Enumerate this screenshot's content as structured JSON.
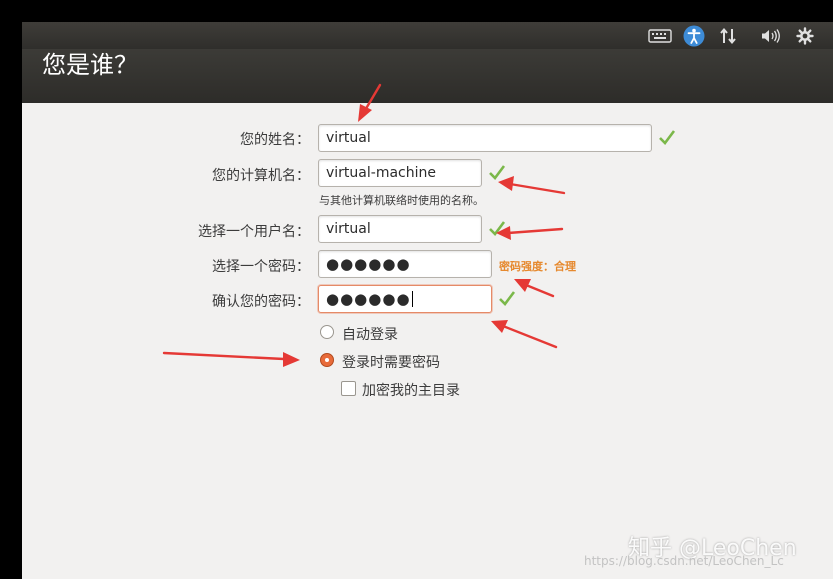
{
  "header": {
    "title": "您是谁？"
  },
  "topbar": {
    "icons": [
      "keyboard-icon",
      "accessibility-icon",
      "network-icon",
      "volume-icon",
      "gear-icon"
    ]
  },
  "form": {
    "name": {
      "label": "您的姓名：",
      "value": "virtual"
    },
    "computer": {
      "label": "您的计算机名：",
      "value": "virtual-machine",
      "hint": "与其他计算机联络时使用的名称。"
    },
    "username": {
      "label": "选择一个用户名：",
      "value": "virtual"
    },
    "password": {
      "label": "选择一个密码：",
      "value": "●●●●●●",
      "strength": "密码强度：合理"
    },
    "confirm": {
      "label": "确认您的密码：",
      "value": "●●●●●●"
    }
  },
  "login": {
    "auto": {
      "label": "自动登录",
      "selected": false
    },
    "require": {
      "label": "登录时需要密码",
      "selected": true
    },
    "encrypt": {
      "label": "加密我的主目录",
      "checked": false
    }
  },
  "watermark": {
    "text": "知乎 @LeoChen",
    "url": "https://blog.csdn.net/LeoChen_Lc"
  },
  "colors": {
    "check": "#7bb84a",
    "annotation": "#e53935",
    "accent": "#e86b3a",
    "strength": "#e6892e"
  }
}
